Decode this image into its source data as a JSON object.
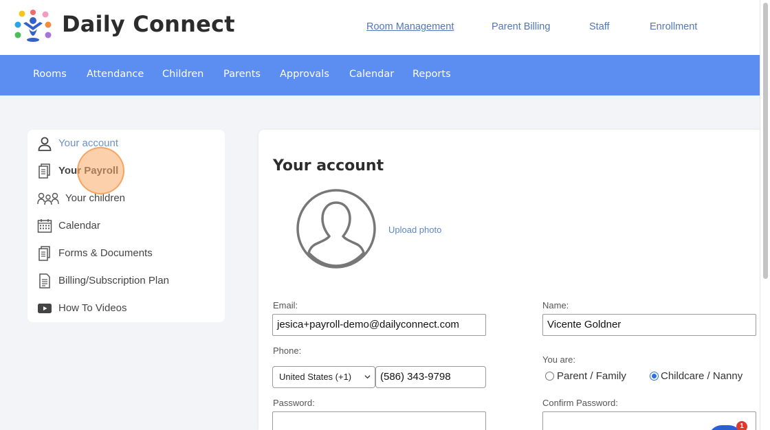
{
  "brand": {
    "name": "Daily Connect"
  },
  "top_nav": {
    "items": [
      "Room Management",
      "Parent Billing",
      "Staff",
      "Enrollment"
    ]
  },
  "main_nav": {
    "items": [
      "Rooms",
      "Attendance",
      "Children",
      "Parents",
      "Approvals",
      "Calendar",
      "Reports"
    ]
  },
  "sidebar": {
    "items": [
      {
        "label": "Your account",
        "icon": "person-icon"
      },
      {
        "label": "Your Payroll",
        "icon": "documents-icon"
      },
      {
        "label": "Your children",
        "icon": "group-icon"
      },
      {
        "label": "Calendar",
        "icon": "calendar-icon"
      },
      {
        "label": "Forms & Documents",
        "icon": "documents-icon"
      },
      {
        "label": "Billing/Subscription Plan",
        "icon": "file-icon"
      },
      {
        "label": "How To Videos",
        "icon": "play-icon"
      }
    ]
  },
  "account": {
    "title": "Your account",
    "upload_photo": "Upload photo",
    "email_label": "Email:",
    "email_value": "jesica+payroll-demo@dailyconnect.com",
    "name_label": "Name:",
    "name_value": "Vicente Goldner",
    "phone_label": "Phone:",
    "country_value": "United States (+1)",
    "phone_value": "(586) 343-9798",
    "you_are_label": "You are:",
    "role_options": [
      "Parent / Family",
      "Childcare / Nanny"
    ],
    "role_selected": "Childcare / Nanny",
    "password_label": "Password:",
    "confirm_password_label": "Confirm Password:"
  },
  "chat": {
    "badge_count": "1"
  },
  "colors": {
    "nav_blue": "#5b8ef0",
    "link_blue": "#5276b8",
    "chat_blue": "#2c5fd6",
    "badge_red": "#e03a2f"
  }
}
